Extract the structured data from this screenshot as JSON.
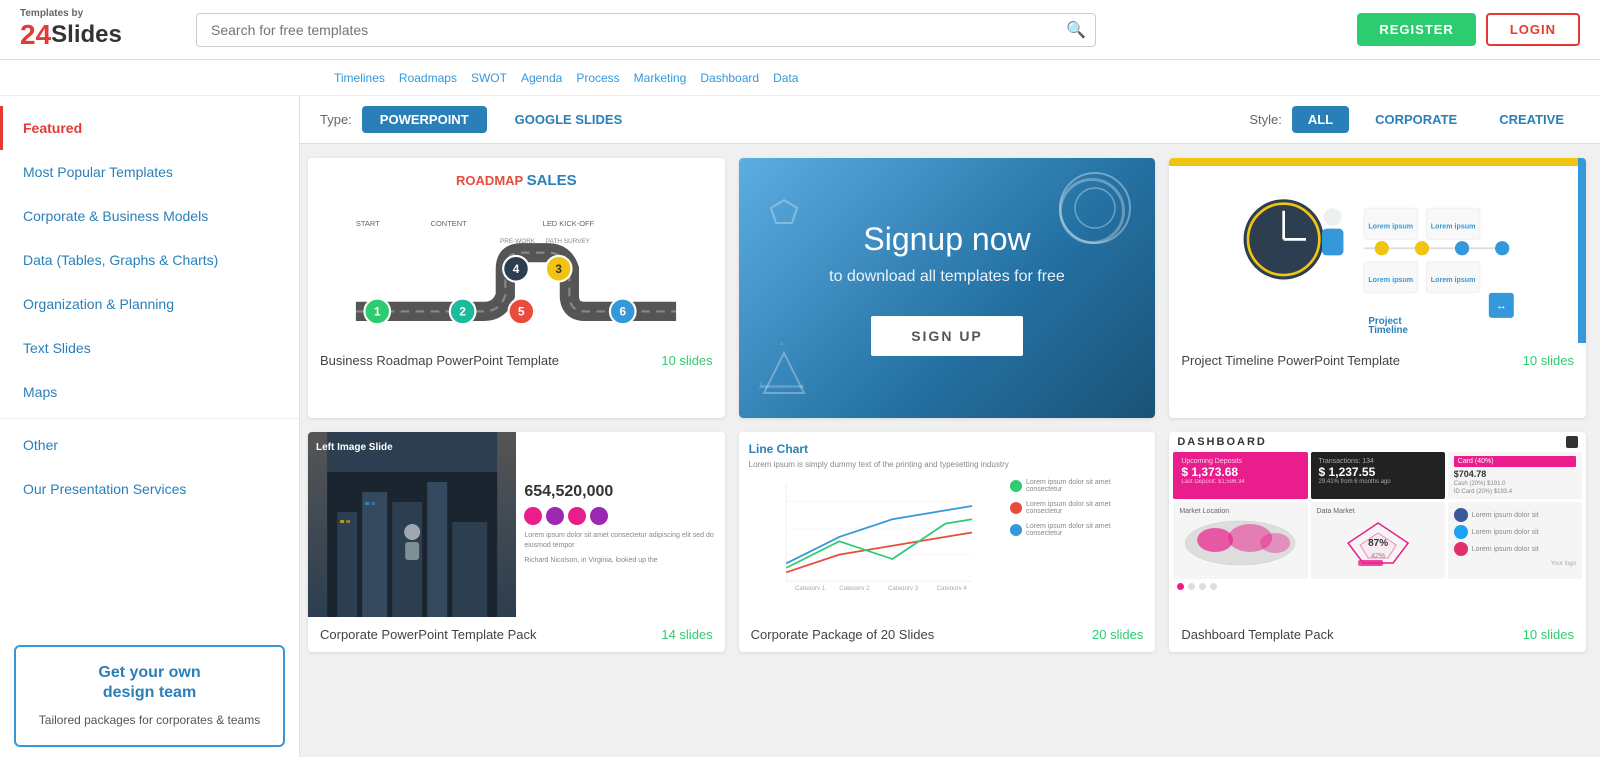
{
  "logo": {
    "by_text": "Templates by",
    "brand": "24Slides"
  },
  "search": {
    "placeholder": "Search for free templates"
  },
  "tags": [
    "Timelines",
    "Roadmaps",
    "SWOT",
    "Agenda",
    "Process",
    "Marketing",
    "Dashboard",
    "Data"
  ],
  "header_actions": {
    "register": "REGISTER",
    "login": "LOGIN"
  },
  "filter": {
    "type_label": "Type:",
    "type_options": [
      "POWERPOINT",
      "GOOGLE SLIDES"
    ],
    "active_type": "POWERPOINT",
    "style_label": "Style:",
    "style_options": [
      "ALL",
      "CORPORATE",
      "CREATIVE"
    ],
    "active_style": "ALL"
  },
  "sidebar": {
    "items": [
      {
        "label": "Featured",
        "type": "active"
      },
      {
        "label": "Most Popular Templates",
        "type": "link"
      },
      {
        "label": "Corporate & Business Models",
        "type": "link"
      },
      {
        "label": "Data (Tables, Graphs & Charts)",
        "type": "link"
      },
      {
        "label": "Organization & Planning",
        "type": "link"
      },
      {
        "label": "Text Slides",
        "type": "link"
      },
      {
        "label": "Maps",
        "type": "link"
      },
      {
        "label": "Other",
        "type": "link"
      },
      {
        "label": "Our Presentation Services",
        "type": "link"
      }
    ],
    "promo": {
      "title": "Get your own design team",
      "subtitle": "Tailored packages for corporates & teams"
    }
  },
  "templates": [
    {
      "id": "roadmap",
      "title": "Business Roadmap PowerPoint Template",
      "slides": "10 slides",
      "type": "roadmap"
    },
    {
      "id": "signup",
      "type": "signup",
      "title": "Signup now",
      "subtitle": "to download all templates for free",
      "btn": "SIGN UP"
    },
    {
      "id": "timeline",
      "title": "Project Timeline PowerPoint Template",
      "slides": "10 slides",
      "type": "timeline"
    },
    {
      "id": "corporate",
      "title": "Corporate PowerPoint Template Pack",
      "slides": "14 slides",
      "type": "corporate"
    },
    {
      "id": "linechart",
      "title": "Corporate Package of 20 Slides",
      "slides": "20 slides",
      "type": "linechart"
    },
    {
      "id": "dashboard",
      "title": "Dashboard Template Pack",
      "slides": "10 slides",
      "type": "dashboard"
    }
  ]
}
